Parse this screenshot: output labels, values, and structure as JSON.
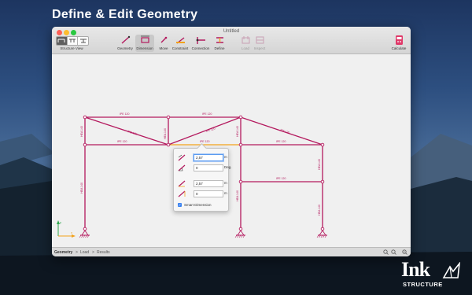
{
  "headline": "Define & Edit Geometry",
  "window": {
    "title": "Untitled"
  },
  "toolbar": {
    "structure_view_label": "Structure View",
    "tools": [
      {
        "label": "Geometry",
        "icon": "geometry-icon",
        "active": false,
        "disabled": false
      },
      {
        "label": "Dimension",
        "icon": "dimension-icon",
        "active": true,
        "disabled": false
      },
      {
        "label": "Move",
        "icon": "move-icon",
        "active": false,
        "disabled": false
      },
      {
        "label": "Constraint",
        "icon": "constraint-icon",
        "active": false,
        "disabled": false
      },
      {
        "label": "Connection",
        "icon": "connection-icon",
        "active": false,
        "disabled": false
      },
      {
        "label": "Define",
        "icon": "define-icon",
        "active": false,
        "disabled": false
      },
      {
        "label": "Load",
        "icon": "load-icon",
        "active": false,
        "disabled": true
      },
      {
        "label": "Inspect",
        "icon": "inspect-icon",
        "active": false,
        "disabled": true
      }
    ],
    "calculate_label": "Calculate"
  },
  "structure": {
    "member_color": "#b4195e",
    "selected_color": "#f2a21b",
    "beam_labels": [
      "IPE 120",
      "IPE 120",
      "IPE 120",
      "IPE 120",
      "IPE 120",
      "IPE 120",
      "IPE 120",
      "IPE 120",
      "IPE 120"
    ],
    "column_labels": [
      "HEA 140",
      "HEA 140",
      "HEA 140",
      "HEA 140",
      "HEA 140",
      "HEA 140",
      "HEA 140"
    ]
  },
  "dimension_popover": {
    "rows": [
      {
        "value": "2,57",
        "unit": "m",
        "focused": true
      },
      {
        "value": "0",
        "unit": "Deg.",
        "focused": false
      },
      {
        "value": "2,57",
        "unit": "m",
        "focused": false
      },
      {
        "value": "0",
        "unit": "m",
        "focused": false
      }
    ],
    "smart_dimension_label": "Smart Dimension",
    "smart_dimension_checked": true
  },
  "statusbar": {
    "breadcrumb": [
      "Geometry",
      "Load",
      "Results"
    ],
    "separator": ">"
  },
  "logo": {
    "name": "Ink",
    "subtitle": "STRUCTURE"
  }
}
